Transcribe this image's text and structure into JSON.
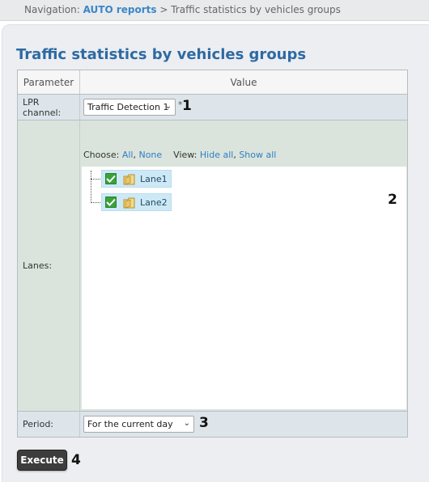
{
  "breadcrumb": {
    "prefix": "Navigation:",
    "link": "AUTO reports",
    "separator": ">",
    "current": "Traffic statistics by vehicles groups"
  },
  "page_title": "Traffic statistics by vehicles groups",
  "table": {
    "col_parameter": "Parameter",
    "col_value": "Value"
  },
  "lpr_channel": {
    "label": "LPR channel:",
    "selected": "Traffic Detection 1",
    "required_mark": "*",
    "marker": "1"
  },
  "lanes": {
    "label": "Lanes:",
    "choose_label": "Choose:",
    "choose_all": "All",
    "choose_none": "None",
    "view_label": "View:",
    "view_hide_all": "Hide all",
    "view_show_all": "Show all",
    "items": [
      {
        "label": "Lane1",
        "checked": true
      },
      {
        "label": "Lane2",
        "checked": true
      }
    ],
    "marker": "2"
  },
  "period": {
    "label": "Period:",
    "selected": "For the current day",
    "marker": "3"
  },
  "execute": {
    "label": "Execute",
    "marker": "4"
  },
  "colors": {
    "title": "#2e6aa3",
    "link": "#3a87c8",
    "row_background": "#dde5eb",
    "lanes_background": "#dbe4dc",
    "tree_selection": "#cde9f6",
    "checkbox": "#3aa23a",
    "button": "#3d3d3d"
  }
}
